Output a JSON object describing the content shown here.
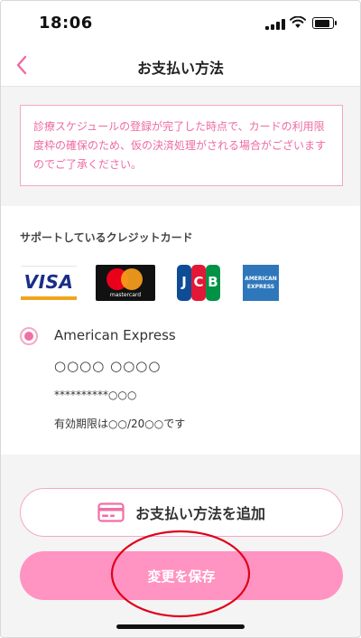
{
  "status_bar": {
    "time": "18:06"
  },
  "header": {
    "title": "お支払い方法",
    "back_icon": "chevron-left-icon"
  },
  "notice": {
    "text": "診療スケジュールの登録が完了した時点で、カードの利用限度枠の確保のため、仮の決済処理がされる場合がございますのでご了承ください。"
  },
  "supported_cards": {
    "heading": "サポートしているクレジットカード",
    "logos": {
      "visa": "VISA",
      "mastercard": "mastercard",
      "jcb": [
        "J",
        "C",
        "B"
      ],
      "amex_line1": "AMERICAN",
      "amex_line2": "EXPRESS"
    }
  },
  "selected_card": {
    "selected": true,
    "brand": "American Express",
    "holder_name": "○○○○ ○○○○",
    "number": "**********○○○",
    "expiry": "有効期限は○○/20○○です"
  },
  "actions": {
    "add_payment_label": "お支払い方法を追加",
    "save_label": "変更を保存"
  },
  "colors": {
    "accent": "#ef6aa3",
    "save_button": "#ff93c2",
    "annotation_circle": "#e0001a"
  }
}
